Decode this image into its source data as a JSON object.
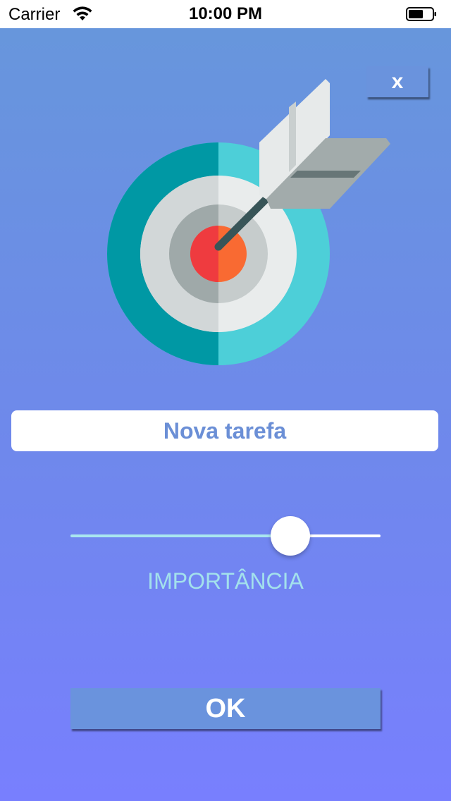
{
  "status_bar": {
    "carrier": "Carrier",
    "time": "10:00 PM"
  },
  "close_button": {
    "label": "x"
  },
  "task_field": {
    "placeholder": "Nova tarefa"
  },
  "importance_slider": {
    "value": 0.74,
    "label": "IMPORTÂNCIA"
  },
  "ok_button": {
    "label": "OK"
  },
  "colors": {
    "background_top": "#6796dc",
    "background_bottom": "#787ffe",
    "button": "#6a93dd",
    "slider_min_track": "#a9e6ef",
    "label_text": "#a3e1ec",
    "input_text": "#6b8fd6"
  },
  "icons": {
    "illustration": "target-with-arrow-icon",
    "wifi": "wifi-icon",
    "battery": "battery-icon"
  }
}
